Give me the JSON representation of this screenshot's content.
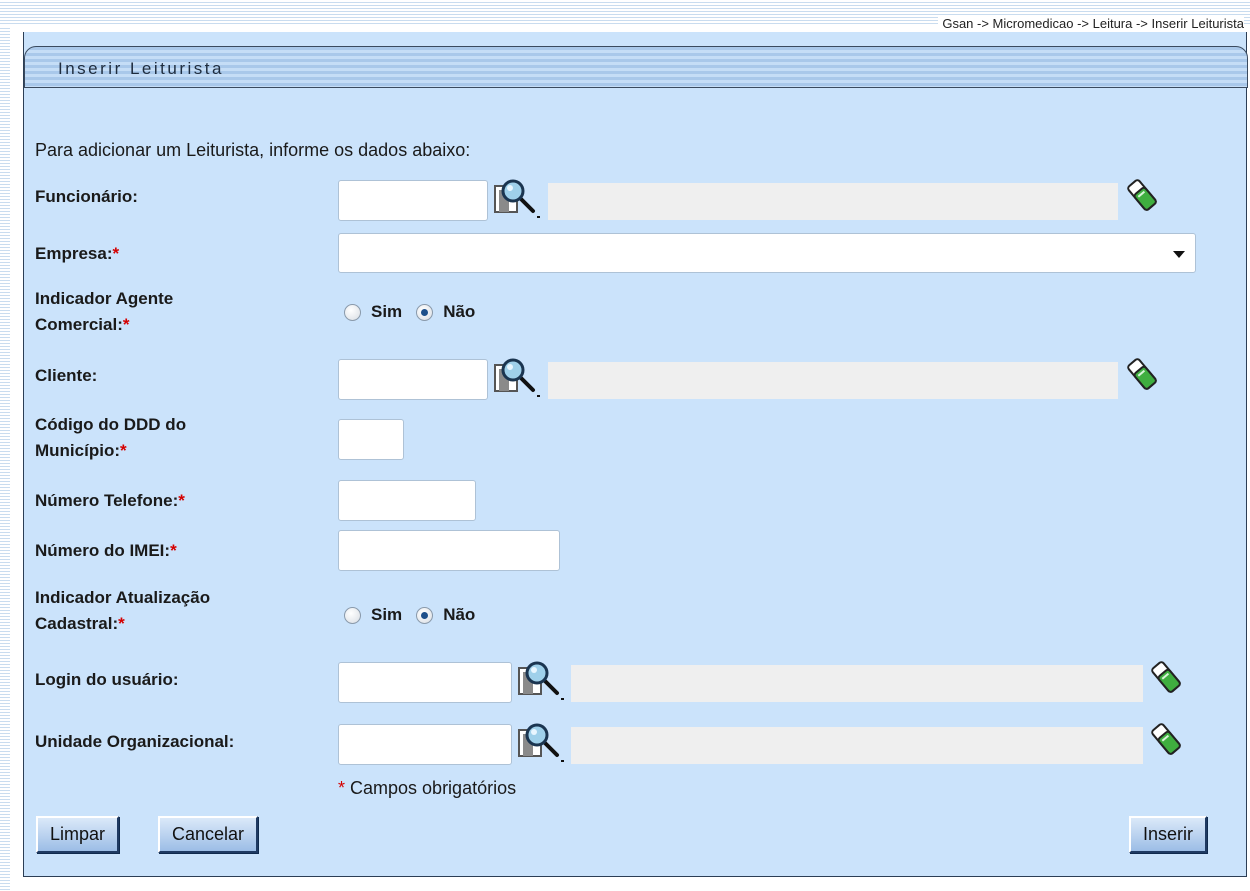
{
  "breadcrumb": "Gsan -> Micromedicao -> Leitura -> Inserir Leiturista",
  "title": "Inserir Leiturista",
  "intro": "Para adicionar um Leiturista, informe os dados abaixo:",
  "fields": {
    "funcionario": {
      "label": "Funcionário:",
      "required": "",
      "value": ""
    },
    "empresa": {
      "label": "Empresa:",
      "required": "*",
      "selected": ""
    },
    "agente_comercial": {
      "label_line1": "Indicador Agente",
      "label_line2": "Comercial:",
      "required": "*",
      "options": [
        "Sim",
        "Não"
      ],
      "selected": "Não"
    },
    "cliente": {
      "label": "Cliente:",
      "required": "",
      "value": ""
    },
    "ddd": {
      "label_line1": "Código do DDD do",
      "label_line2": "Município:",
      "required": "*",
      "value": ""
    },
    "telefone": {
      "label": "Número Telefone:",
      "required": "*",
      "value": ""
    },
    "imei": {
      "label": "Número do IMEI:",
      "required": "*",
      "value": ""
    },
    "atualizacao_cadastral": {
      "label_line1": "Indicador Atualização",
      "label_line2": "Cadastral:",
      "required": "*",
      "options": [
        "Sim",
        "Não"
      ],
      "selected": "Não"
    },
    "login": {
      "label": "Login do usuário:",
      "required": "",
      "value": ""
    },
    "unidade": {
      "label": "Unidade Organizacional:",
      "required": "",
      "value": ""
    }
  },
  "footnote": {
    "asterisk": "*",
    "text": " Campos obrigatórios"
  },
  "buttons": {
    "limpar": "Limpar",
    "cancelar": "Cancelar",
    "inserir": "Inserir"
  },
  "colors": {
    "panel_bg": "#cbe3fb",
    "required": "#d40000",
    "button_border": "#1f3a62"
  },
  "icons": {
    "lookup": "magnifier-lookup-icon",
    "clear": "eraser-icon"
  }
}
